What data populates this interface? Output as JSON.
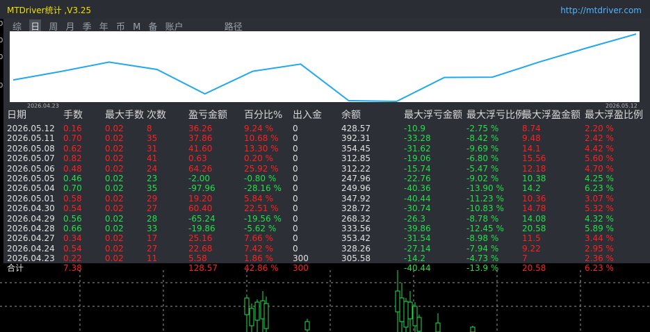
{
  "window": {
    "title": "MTDriver统计 ,V3.25",
    "url": "http://mtdriver.com"
  },
  "tabs": [
    {
      "label": "综",
      "active": false
    },
    {
      "label": "日",
      "active": true
    },
    {
      "label": "周",
      "active": false
    },
    {
      "label": "月",
      "active": false
    },
    {
      "label": "季",
      "active": false
    },
    {
      "label": "年",
      "active": false
    },
    {
      "label": "币",
      "active": false
    },
    {
      "label": "M",
      "active": false
    },
    {
      "label": "备",
      "active": false
    },
    {
      "label": "账户",
      "active": false
    },
    {
      "label": "路径",
      "active": false
    }
  ],
  "chart_data": {
    "type": "line",
    "x_start_label": "2026.04.23",
    "x_end_label": "2026.05.12",
    "x": [
      "2026.04.23",
      "2026.04.24",
      "2026.04.27",
      "2026.04.28",
      "2026.04.29",
      "2026.04.30",
      "2026.05.01",
      "2026.05.04",
      "2026.05.05",
      "2026.05.06",
      "2026.05.07",
      "2026.05.08",
      "2026.05.11",
      "2026.05.12"
    ],
    "values": [
      305.58,
      328.26,
      353.42,
      333.56,
      268.32,
      328.72,
      347.92,
      249.96,
      247.96,
      312.22,
      312.85,
      354.45,
      392.31,
      428.57
    ],
    "line_color": "#1fa8ef"
  },
  "table": {
    "headers": [
      "日期",
      "手数",
      "最大手数",
      "次数",
      "盈亏金额",
      "百分比%",
      "出入金",
      "余额",
      "最大浮亏金额",
      "最大浮亏比例",
      "最大浮盈金额",
      "最大浮盈比例"
    ],
    "rows": [
      {
        "date": "2026.05.12",
        "lots": "0.16",
        "maxlots": "0.02",
        "count": "8",
        "pl": "36.26",
        "pct": "9.24 %",
        "dep": "0",
        "bal": "428.57",
        "mdd": "-10.9",
        "mddp": "-2.75 %",
        "mfe": "8.74",
        "mfep": "2.20 %",
        "pos": true
      },
      {
        "date": "2026.05.11",
        "lots": "0.70",
        "maxlots": "0.02",
        "count": "35",
        "pl": "37.86",
        "pct": "10.68 %",
        "dep": "0",
        "bal": "392.31",
        "mdd": "-33.28",
        "mddp": "-8.42 %",
        "mfe": "9.48",
        "mfep": "2.42 %",
        "pos": true
      },
      {
        "date": "2026.05.08",
        "lots": "0.62",
        "maxlots": "0.02",
        "count": "31",
        "pl": "41.60",
        "pct": "13.30 %",
        "dep": "0",
        "bal": "354.45",
        "mdd": "-31.62",
        "mddp": "-9.69 %",
        "mfe": "14.1",
        "mfep": "4.42 %",
        "pos": true
      },
      {
        "date": "2026.05.07",
        "lots": "0.82",
        "maxlots": "0.02",
        "count": "41",
        "pl": "0.63",
        "pct": "0.20 %",
        "dep": "0",
        "bal": "312.85",
        "mdd": "-19.06",
        "mddp": "-6.80 %",
        "mfe": "15.56",
        "mfep": "5.60 %",
        "pos": true
      },
      {
        "date": "2026.05.06",
        "lots": "0.48",
        "maxlots": "0.02",
        "count": "24",
        "pl": "64.26",
        "pct": "25.92 %",
        "dep": "0",
        "bal": "312.22",
        "mdd": "-15.74",
        "mddp": "-5.47 %",
        "mfe": "12.18",
        "mfep": "4.70 %",
        "pos": true
      },
      {
        "date": "2026.05.05",
        "lots": "0.46",
        "maxlots": "0.02",
        "count": "23",
        "pl": "-2.00",
        "pct": "-0.80 %",
        "dep": "0",
        "bal": "247.96",
        "mdd": "-22.76",
        "mddp": "-9.02 %",
        "mfe": "10.38",
        "mfep": "4.25 %",
        "pos": false
      },
      {
        "date": "2026.05.04",
        "lots": "0.70",
        "maxlots": "0.02",
        "count": "35",
        "pl": "-97.96",
        "pct": "-28.16 %",
        "dep": "0",
        "bal": "249.96",
        "mdd": "-40.36",
        "mddp": "-13.90 %",
        "mfe": "14.2",
        "mfep": "6.23 %",
        "pos": false
      },
      {
        "date": "2026.05.01",
        "lots": "0.58",
        "maxlots": "0.02",
        "count": "29",
        "pl": "19.20",
        "pct": "5.84 %",
        "dep": "0",
        "bal": "347.92",
        "mdd": "-40.44",
        "mddp": "-11.23 %",
        "mfe": "10.36",
        "mfep": "3.07 %",
        "pos": true
      },
      {
        "date": "2026.04.30",
        "lots": "0.54",
        "maxlots": "0.02",
        "count": "27",
        "pl": "60.40",
        "pct": "22.51 %",
        "dep": "0",
        "bal": "328.72",
        "mdd": "-30.74",
        "mddp": "-10.83 %",
        "mfe": "14.78",
        "mfep": "5.32 %",
        "pos": true
      },
      {
        "date": "2026.04.29",
        "lots": "0.56",
        "maxlots": "0.02",
        "count": "28",
        "pl": "-65.24",
        "pct": "-19.56 %",
        "dep": "0",
        "bal": "268.32",
        "mdd": "-26.3",
        "mddp": "-8.78 %",
        "mfe": "14.08",
        "mfep": "4.32 %",
        "pos": false
      },
      {
        "date": "2026.04.28",
        "lots": "0.66",
        "maxlots": "0.02",
        "count": "33",
        "pl": "-19.86",
        "pct": "-5.62 %",
        "dep": "0",
        "bal": "333.56",
        "mdd": "-39.86",
        "mddp": "-12.45 %",
        "mfe": "20.58",
        "mfep": "5.89 %",
        "pos": false
      },
      {
        "date": "2026.04.27",
        "lots": "0.34",
        "maxlots": "0.02",
        "count": "17",
        "pl": "25.16",
        "pct": "7.66 %",
        "dep": "0",
        "bal": "353.42",
        "mdd": "-31.54",
        "mddp": "-8.98 %",
        "mfe": "11.5",
        "mfep": "3.44 %",
        "pos": true
      },
      {
        "date": "2026.04.24",
        "lots": "0.54",
        "maxlots": "0.02",
        "count": "27",
        "pl": "22.68",
        "pct": "7.42 %",
        "dep": "0",
        "bal": "328.26",
        "mdd": "-27.14",
        "mddp": "-7.94 %",
        "mfe": "9.22",
        "mfep": "2.95 %",
        "pos": true
      },
      {
        "date": "2026.04.23",
        "lots": "0.22",
        "maxlots": "0.02",
        "count": "11",
        "pl": "5.58",
        "pct": "1.86 %",
        "dep": "300",
        "bal": "305.58",
        "mdd": "-14.2",
        "mddp": "-4.73 %",
        "mfe": "7",
        "mfep": "2.36 %",
        "pos": true
      }
    ],
    "total": {
      "label": "合计",
      "lots": "7.38",
      "pl": "128.57",
      "pct": "42.86 %",
      "dep": "300",
      "mdd": "-40.44",
      "mddp": "-13.9 %",
      "mfe": "20.58",
      "mfep": "6.23 %"
    }
  },
  "price_axis": [
    "0",
    "0",
    "0",
    "0"
  ],
  "colors": {
    "positive": "#ff2020",
    "negative": "#22e04a",
    "title": "#f0e000",
    "url": "#4fb6ff",
    "panel": "#2c2f35"
  }
}
